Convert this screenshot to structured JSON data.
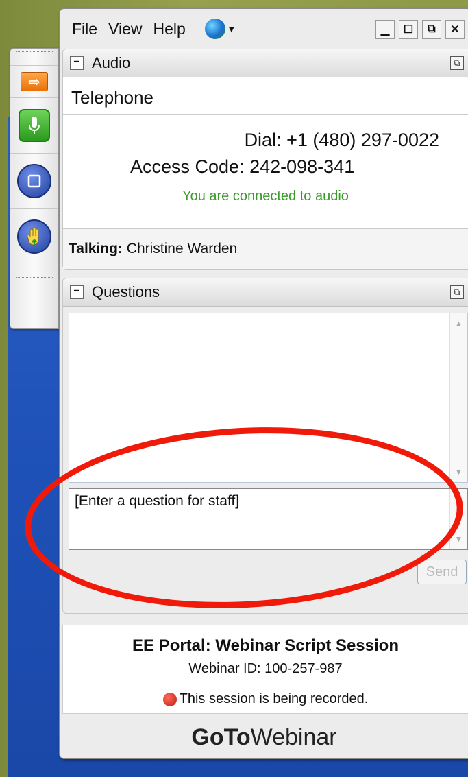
{
  "menu": {
    "file": "File",
    "view": "View",
    "help": "Help"
  },
  "window_controls": {
    "minimize": "▁",
    "maximize": "☐",
    "restore": "⧉",
    "close": "✕"
  },
  "toolbar": {
    "icons": [
      "arrow-icon",
      "microphone-icon",
      "screen-icon",
      "hand-icon"
    ],
    "arrow_glyph": "⇨"
  },
  "audio": {
    "header": "Audio",
    "mode": "Telephone",
    "dial": "Dial: +1 (480) 297-0022",
    "access": "Access Code: 242-098-341",
    "status": "You are connected to audio",
    "talking_label": "Talking:",
    "talking_name": "Christine Warden"
  },
  "questions": {
    "header": "Questions",
    "input_value": "[Enter a question for staff]",
    "send_label": "Send"
  },
  "session": {
    "title": "EE Portal: Webinar Script Session",
    "id": "Webinar ID: 100-257-987",
    "recording": "This session is being recorded."
  },
  "brand": {
    "bold": "GoTo",
    "rest": "Webinar"
  },
  "colors": {
    "accent_green": "#3a9a2a",
    "annotation_red": "#f01a0a",
    "record_red": "#c01a10"
  }
}
